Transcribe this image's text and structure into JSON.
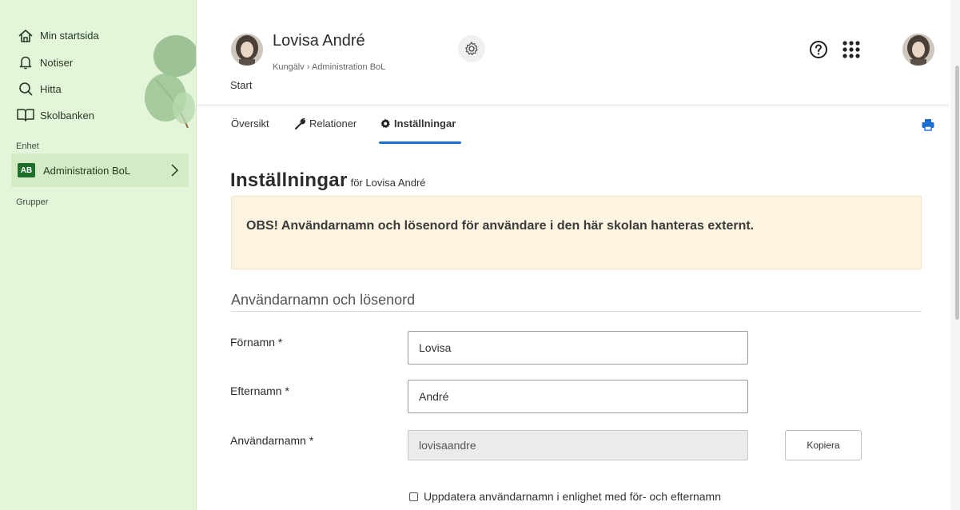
{
  "sidebar": {
    "nav": [
      {
        "label": "Min startsida",
        "icon": "home-icon"
      },
      {
        "label": "Notiser",
        "icon": "bell-icon"
      },
      {
        "label": "Hitta",
        "icon": "search-icon"
      },
      {
        "label": "Skolbanken",
        "icon": "book-icon"
      }
    ],
    "unit_section_label": "Enhet",
    "unit": {
      "badge": "AB",
      "label": "Administration BoL"
    },
    "groups_label": "Grupper"
  },
  "header": {
    "user_name": "Lovisa André",
    "breadcrumb_school": "Kungälv",
    "breadcrumb_separator": "›",
    "breadcrumb_unit": "Administration BoL",
    "start_label": "Start"
  },
  "tabs": [
    {
      "label": "Översikt"
    },
    {
      "label": "Relationer",
      "icon": "wrench-icon"
    },
    {
      "label": "Inställningar",
      "icon": "gear-icon",
      "active": true
    }
  ],
  "page": {
    "title": "Inställningar",
    "title_suffix": "för Lovisa André",
    "notice": "OBS! Användarnamn och lösenord för användare i den här skolan hanteras externt.",
    "section_heading": "Användarnamn och lösenord",
    "fields": {
      "firstname_label": "Förnamn *",
      "firstname_value": "Lovisa",
      "lastname_label": "Efternamn *",
      "lastname_value": "André",
      "username_label": "Användarnamn *",
      "username_value": "lovisaandre"
    },
    "copy_button": "Kopiera",
    "update_checkbox_label": "Uppdatera användarnamn i enlighet med för- och efternamn"
  },
  "colors": {
    "sidebar_bg": "#e3f6d9",
    "unit_badge": "#1f6e2c",
    "tab_active_underline": "#1a6fd1",
    "notice_bg": "#fcf3e1"
  }
}
